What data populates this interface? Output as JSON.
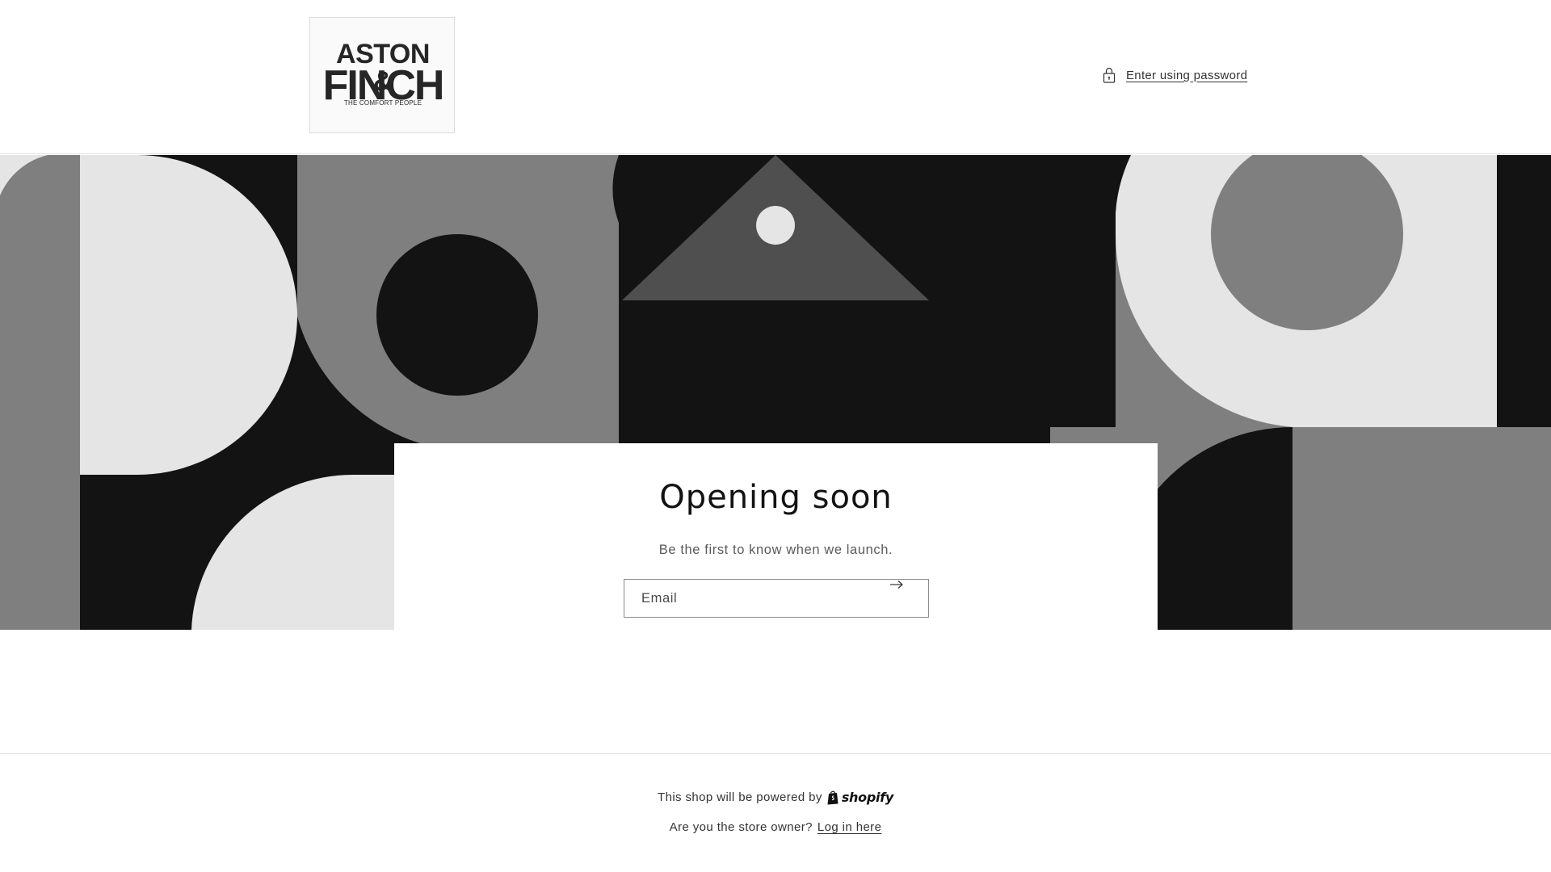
{
  "header": {
    "logo": {
      "line1": "ASTON &",
      "line2": "FINCH",
      "line3": "THE COMFORT PEOPLE"
    },
    "password_link": {
      "icon": "lock-icon",
      "label": "Enter using password"
    }
  },
  "banner": {
    "colors": {
      "black": "#131313",
      "dark_gray": "#4f4f4f",
      "mid_gray": "#7f7f7f",
      "light_gray": "#e5e5e5"
    }
  },
  "card": {
    "title": "Opening soon",
    "subtitle": "Be the first to know when we launch.",
    "email": {
      "placeholder": "Email",
      "value": "",
      "submit_icon": "arrow-right-icon"
    }
  },
  "footer": {
    "powered_text": "This shop will be powered by",
    "shopify_label": "shopify",
    "owner_text": "Are you the store owner?",
    "login_link": "Log in here"
  }
}
